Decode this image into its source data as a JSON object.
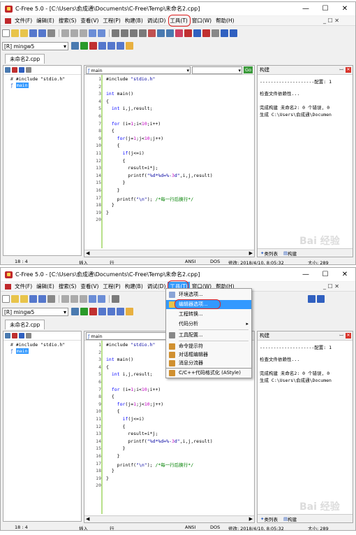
{
  "title": "C-Free 5.0 - [C:\\Users\\俞成通\\Documents\\C-Free\\Temp\\未命名2.cpp]",
  "menu": [
    "文件(F)",
    "编辑(E)",
    "搜索(S)",
    "查看(V)",
    "工程(P)",
    "构建(B)",
    "调试(D)",
    "工具(T)",
    "窗口(W)",
    "帮助(H)"
  ],
  "compiler": "[R] mingw5",
  "file_tab": "未命名2.cpp",
  "tree": {
    "include": "#include \"stdio.h\"",
    "main": "main"
  },
  "editor_combo": "main",
  "go_label": "Go",
  "code_lines": [
    "#include \"stdio.h\"",
    "",
    "int main()",
    "{",
    "  int i,j,result;",
    "",
    "  for (i=1;i<10;i++)",
    "  {",
    "    for(j=1;j<10;j++)",
    "    {",
    "      if(j<=i)",
    "      {",
    "        result=i*j;",
    "        printf(\"%d*%d=%-3d\",i,j,result)",
    "      }",
    "    }",
    "    printf(\"\\n\"); /*每一行后换行*/",
    "  }",
    "}",
    "",
    ""
  ],
  "line_numbers": [
    "1",
    "2",
    "3",
    "4",
    "5",
    "6",
    "7",
    "8",
    "9",
    "10",
    "11",
    "12",
    "13",
    "14",
    "15",
    "16",
    "17",
    "18",
    "19",
    "20"
  ],
  "build_panel": {
    "title": "构建",
    "separator": "--------------------配置: 1",
    "lines": [
      "检查文件依赖性...",
      "完成构建 未命名2: 0 个错误, 0",
      "生成 C:\\Users\\俞成通\\Documen"
    ],
    "tabs": [
      "类列表",
      "构建"
    ]
  },
  "status": {
    "pos": "18 : 4",
    "mode": "插入",
    "unit": "行",
    "enc": "ANSI",
    "eol": "DOS",
    "modified": "修改: 2018/4/10, 8:05:32",
    "size": "大小: 289"
  },
  "tools_menu": [
    "环境选项...",
    "编辑器选项...",
    "工程转换...",
    "代码分析",
    "工具配置...",
    "命令提示符",
    "对话框编辑器",
    "消息分流器",
    "C/C++代码格式化 (AStyle)"
  ],
  "watermark": "Bai 经验",
  "colors": {
    "keyword": "#0000ff",
    "string": "#0000a0",
    "number": "#c000c0",
    "comment": "#008000",
    "accent": "#3399ff",
    "annotation": "#e02020"
  }
}
